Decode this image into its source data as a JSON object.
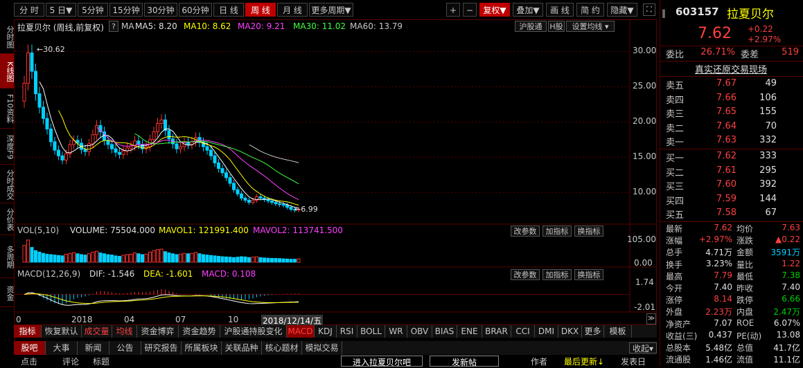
{
  "left_nav": [
    "分时图",
    "K线图",
    "F10资料",
    "深度F9",
    "分时成交",
    "分价表",
    "多周期",
    "资金"
  ],
  "left_nav_active": 1,
  "toolbar": {
    "periods": [
      "分 时",
      "5 日▼",
      "5分钟",
      "15分钟",
      "30分钟",
      "60分钟",
      "日 线",
      "周 线",
      "月 线",
      "更多周期▼"
    ],
    "active_period": 7,
    "right_buttons": [
      "+",
      "−",
      "复权▼",
      "叠加▼",
      "画 线",
      "简 约",
      "隐藏▼"
    ]
  },
  "header": {
    "stock_title": "拉夏贝尔 (周线,前复权)",
    "q": "?",
    "ma_label": "MA",
    "ma5": "MA5: 8.20",
    "ma10": "MA10: 8.62",
    "ma20": "MA20: 9.21",
    "ma30": "MA30: 11.02",
    "ma60": "MA60: 13.79",
    "hgt": "沪股通",
    "hshare": "H股",
    "set_ma": "设置均线"
  },
  "price_axis": [
    "30.00",
    "25.00",
    "20.00",
    "15.00",
    "10.00"
  ],
  "price_high": "30.62",
  "price_low": "6.99",
  "vol_header": {
    "name": "VOL(5,10)",
    "volume": "VOLUME: 75504.000",
    "mavol1": "MAVOL1: 121991.400",
    "mavol2": "MAVOL2: 113741.500"
  },
  "vol_axis": [
    "105.00",
    "0.00"
  ],
  "macd_header": {
    "name": "MACD(12,26,9)",
    "dif": "DIF: -1.546",
    "dea": "DEA: -1.601",
    "macd": "MACD: 0.108"
  },
  "macd_axis": [
    "1.74",
    "-2.01"
  ],
  "panel_buttons": [
    "改参数",
    "加指标",
    "换指标"
  ],
  "time_axis": [
    "0",
    "2018",
    "04",
    "07",
    "10"
  ],
  "cursor_date": "2018/12/14/五",
  "indicator_tabs": [
    "指标",
    "恢复默认",
    "成交量",
    "均线",
    "资金博弈",
    "资金趋势",
    "沪股通持股变化",
    "MACD",
    "KDJ",
    "RSI",
    "BOLL",
    "WR",
    "OBV",
    "BIAS",
    "ENE",
    "BRAR",
    "CCI",
    "DMI",
    "DKX",
    "更多",
    "模板"
  ],
  "news_tabs": [
    "股吧",
    "大事",
    "新闻",
    "公告",
    "研究报告",
    "所属板块",
    "关联品种",
    "核心题材",
    "模拟交易"
  ],
  "collapse": "收起",
  "footer": {
    "c1": "点击",
    "c2": "评论",
    "c3": "标题",
    "enter": "进入拉夏贝尔吧",
    "post": "发新帖",
    "author": "作者",
    "latest": "最后更新↓",
    "time": "发表日"
  },
  "quote": {
    "code": "603157",
    "name": "拉夏贝尔",
    "price": "7.62",
    "change": "+0.22",
    "pct": "+2.97%",
    "weibi_label": "委比",
    "weibi": "26.71%",
    "weicha_label": "委差",
    "weicha": "519",
    "real": "真实还原交易现场",
    "sell": [
      {
        "label": "卖五",
        "price": "7.67",
        "vol": "49"
      },
      {
        "label": "卖四",
        "price": "7.66",
        "vol": "106"
      },
      {
        "label": "卖三",
        "price": "7.65",
        "vol": "155"
      },
      {
        "label": "卖二",
        "price": "7.64",
        "vol": "70"
      },
      {
        "label": "卖一",
        "price": "7.63",
        "vol": "332"
      }
    ],
    "buy": [
      {
        "label": "买一",
        "price": "7.62",
        "vol": "333"
      },
      {
        "label": "买二",
        "price": "7.61",
        "vol": "295"
      },
      {
        "label": "买三",
        "price": "7.60",
        "vol": "392"
      },
      {
        "label": "买四",
        "price": "7.59",
        "vol": "144"
      },
      {
        "label": "买五",
        "price": "7.58",
        "vol": "67"
      }
    ],
    "stats": [
      {
        "l1": "最新",
        "v1": "7.62",
        "c1": "red",
        "l2": "均价",
        "v2": "7.63",
        "c2": "red"
      },
      {
        "l1": "涨幅",
        "v1": "+2.97%",
        "c1": "red",
        "l2": "涨跌",
        "v2": "▲0.22",
        "c2": "red"
      },
      {
        "l1": "总手",
        "v1": "4.71万",
        "c1": "white",
        "l2": "金额",
        "v2": "3591万",
        "c2": "cyan"
      },
      {
        "l1": "换手",
        "v1": "3.23%",
        "c1": "white",
        "l2": "量比",
        "v2": "1.22",
        "c2": "red"
      },
      {
        "l1": "最高",
        "v1": "7.79",
        "c1": "red",
        "l2": "最低",
        "v2": "7.38",
        "c2": "green"
      },
      {
        "l1": "今开",
        "v1": "7.40",
        "c1": "white",
        "l2": "昨收",
        "v2": "7.40",
        "c2": "white"
      },
      {
        "l1": "涨停",
        "v1": "8.14",
        "c1": "red",
        "l2": "跌停",
        "v2": "6.66",
        "c2": "green"
      },
      {
        "l1": "外盘",
        "v1": "2.23万",
        "c1": "red",
        "l2": "内盘",
        "v2": "2.47万",
        "c2": "green"
      },
      {
        "l1": "净资产",
        "v1": "7.07",
        "c1": "white",
        "l2": "ROE",
        "v2": "6.07%",
        "c2": "white"
      },
      {
        "l1": "收益(三)",
        "v1": "0.437",
        "c1": "white",
        "l2": "PE(动)",
        "v2": "13.08",
        "c2": "white"
      },
      {
        "l1": "总股本",
        "v1": "5.48亿",
        "c1": "white",
        "l2": "总值",
        "v2": "41.7亿",
        "c2": "white"
      },
      {
        "l1": "流通股",
        "v1": "1.46亿",
        "c1": "white",
        "l2": "流值",
        "v2": "11.1亿",
        "c2": "white"
      }
    ]
  },
  "colors": {
    "up": "#ff3030",
    "down": "#00d0ff",
    "ma5": "#ffffff",
    "ma10": "#ffff00",
    "ma20": "#ff40ff",
    "ma30": "#40ff40",
    "ma60": "#c8c8c8"
  },
  "chart_data": {
    "type": "candlestick",
    "price_ylim": [
      6.0,
      32.5
    ],
    "weekly_close": [
      25.5,
      29.8,
      27.2,
      24.0,
      22.1,
      20.5,
      19.0,
      17.2,
      16.0,
      15.2,
      14.6,
      15.5,
      16.8,
      17.4,
      17.0,
      16.1,
      15.8,
      16.9,
      18.2,
      19.5,
      18.6,
      17.4,
      16.8,
      16.2,
      15.7,
      15.4,
      15.9,
      16.3,
      16.6,
      17.3,
      16.8,
      16.2,
      16.5,
      17.5,
      18.6,
      19.8,
      20.3,
      18.8,
      17.6,
      16.9,
      16.2,
      16.5,
      17.1,
      16.8,
      17.2,
      17.8,
      17.1,
      16.5,
      16.0,
      15.2,
      14.2,
      13.4,
      12.8,
      12.1,
      11.3,
      10.4,
      9.8,
      9.2,
      8.9,
      8.6,
      8.9,
      9.4,
      9.2,
      9.0,
      8.8,
      8.6,
      8.4,
      8.3,
      8.2,
      7.9,
      7.6,
      7.5,
      7.62
    ],
    "volume": [
      80,
      105,
      70,
      55,
      48,
      42,
      38,
      36,
      34,
      32,
      30,
      38,
      42,
      45,
      40,
      36,
      34,
      40,
      48,
      52,
      44,
      40,
      36,
      34,
      30,
      28,
      33,
      36,
      38,
      44,
      40,
      36,
      38,
      48,
      55,
      60,
      62,
      50,
      44,
      40,
      36,
      38,
      42,
      40,
      42,
      46,
      40,
      36,
      34,
      32,
      30,
      28,
      26,
      25,
      24,
      22,
      24,
      26,
      25,
      22,
      24,
      26,
      22,
      20,
      19,
      18,
      18,
      17,
      16,
      15,
      14,
      14,
      16
    ],
    "macd_ylim": [
      -2.01,
      1.74
    ]
  }
}
